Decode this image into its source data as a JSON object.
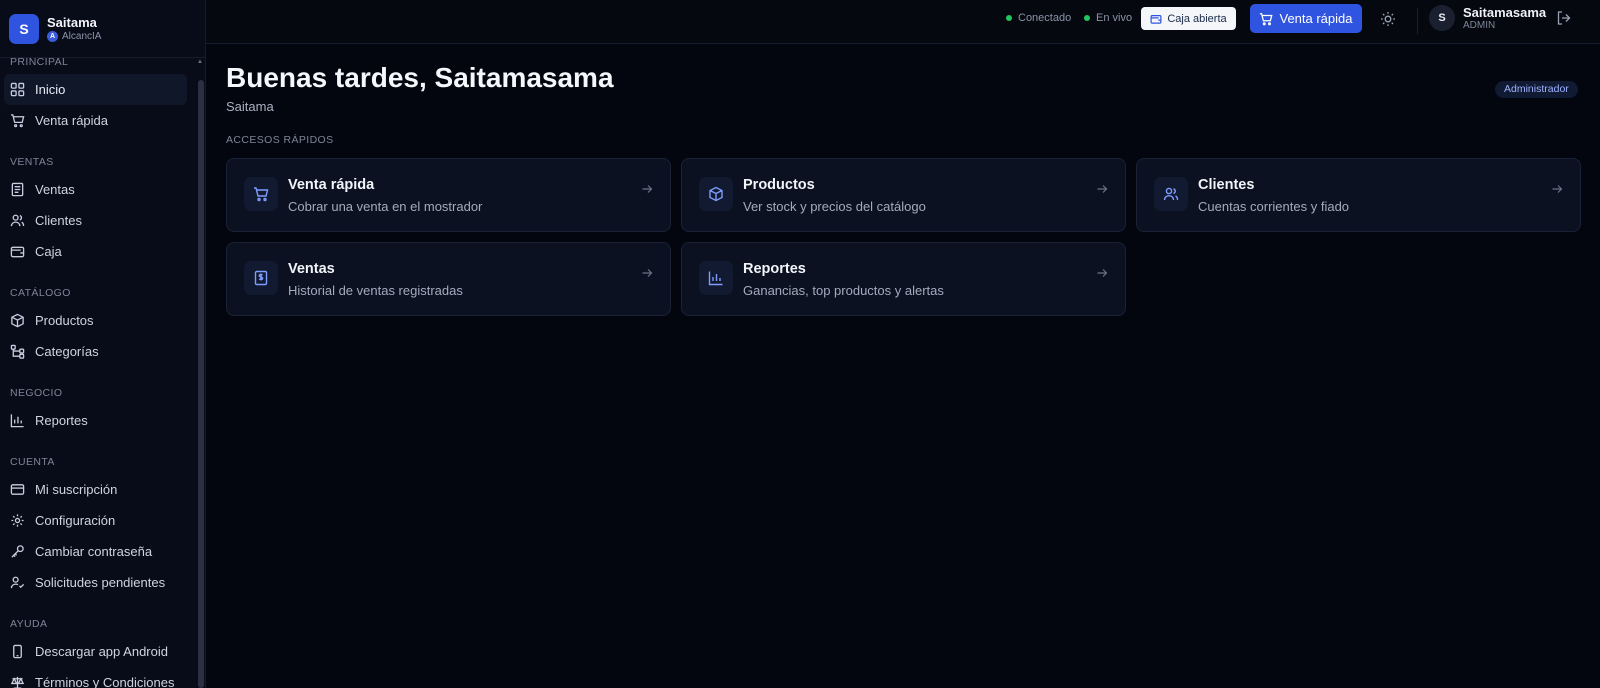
{
  "brand": {
    "initial": "S",
    "name": "Saitama",
    "sub_initial": "A",
    "sub": "AlcancIA"
  },
  "sidebar": {
    "sections": [
      {
        "label": "PRINCIPAL",
        "items": [
          {
            "label": "Inicio",
            "icon": "grid-icon",
            "active": true
          },
          {
            "label": "Venta rápida",
            "icon": "cart-icon"
          }
        ]
      },
      {
        "label": "VENTAS",
        "items": [
          {
            "label": "Ventas",
            "icon": "receipt-icon"
          },
          {
            "label": "Clientes",
            "icon": "users-icon"
          },
          {
            "label": "Caja",
            "icon": "wallet-icon"
          }
        ]
      },
      {
        "label": "CATÁLOGO",
        "items": [
          {
            "label": "Productos",
            "icon": "package-icon"
          },
          {
            "label": "Categorías",
            "icon": "tree-icon"
          }
        ]
      },
      {
        "label": "NEGOCIO",
        "items": [
          {
            "label": "Reportes",
            "icon": "bar-chart-icon"
          }
        ]
      },
      {
        "label": "CUENTA",
        "items": [
          {
            "label": "Mi suscripción",
            "icon": "credit-card-icon"
          },
          {
            "label": "Configuración",
            "icon": "gear-icon"
          },
          {
            "label": "Cambiar contraseña",
            "icon": "key-icon"
          },
          {
            "label": "Solicitudes pendientes",
            "icon": "user-clock-icon"
          }
        ]
      },
      {
        "label": "AYUDA",
        "items": [
          {
            "label": "Descargar app Android",
            "icon": "phone-icon"
          },
          {
            "label": "Términos y Condiciones",
            "icon": "scale-icon"
          }
        ]
      }
    ]
  },
  "topbar": {
    "status_connected": "Conectado",
    "status_live": "En vivo",
    "caja_label": "Caja abierta",
    "venta_label": "Venta rápida",
    "avatar_initial": "S",
    "user_name": "Saitamasama",
    "user_role": "ADMIN"
  },
  "main": {
    "greeting": "Buenas tardes, Saitamasama",
    "subname": "Saitama",
    "role_badge": "Administrador",
    "section_label": "ACCESOS RÁPIDOS",
    "cards": [
      {
        "title": "Venta rápida",
        "desc": "Cobrar una venta en el mostrador",
        "icon": "cart-icon"
      },
      {
        "title": "Productos",
        "desc": "Ver stock y precios del catálogo",
        "icon": "package-icon"
      },
      {
        "title": "Clientes",
        "desc": "Cuentas corrientes y fiado",
        "icon": "users-icon"
      },
      {
        "title": "Ventas",
        "desc": "Historial de ventas registradas",
        "icon": "receipt-icon"
      },
      {
        "title": "Reportes",
        "desc": "Ganancias, top productos y alertas",
        "icon": "bar-chart-icon"
      }
    ]
  },
  "colors": {
    "accent": "#2f54e0",
    "status_ok": "#22c55e",
    "icon_tint": "#7f9cff"
  }
}
